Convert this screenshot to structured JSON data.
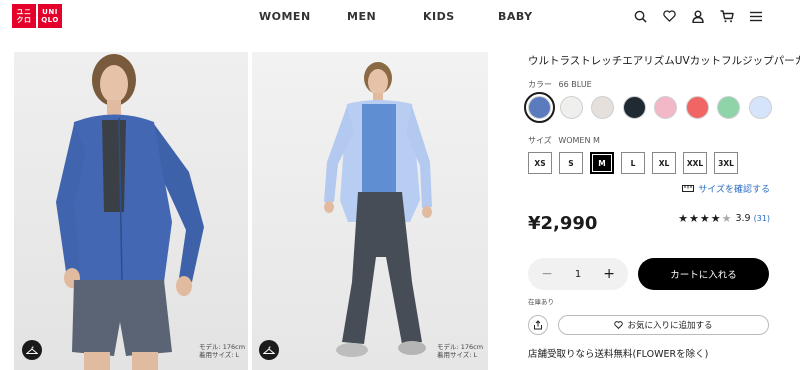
{
  "header": {
    "logo": {
      "top_left": "ユニ",
      "bottom_left": "クロ",
      "top_right": "UNI",
      "bottom_right": "QLO",
      "color": "#e4002b"
    },
    "nav": [
      "WOMEN",
      "MEN",
      "KIDS",
      "BABY"
    ],
    "icons": [
      "search-icon",
      "heart-icon",
      "user-icon",
      "cart-icon",
      "menu-icon"
    ]
  },
  "images": {
    "note_1_line1": "モデル: 176cm",
    "note_1_line2": "着用サイズ: L",
    "note_2_line1": "モデル: 176cm",
    "note_2_line2": "着用サイズ: L"
  },
  "product": {
    "title": "ウルトラストレッチエアリズムUVカットフルジップパーカ",
    "color_label": "カラー",
    "color_value": "66 BLUE",
    "swatches": [
      {
        "name": "blue",
        "hex": "#5b7bbf",
        "selected": true
      },
      {
        "name": "off-white",
        "hex": "#efefed"
      },
      {
        "name": "light-gray",
        "hex": "#e5e0dc"
      },
      {
        "name": "navy",
        "hex": "#1f2a33"
      },
      {
        "name": "pink",
        "hex": "#f2b8c8"
      },
      {
        "name": "red",
        "hex": "#f26565"
      },
      {
        "name": "green",
        "hex": "#8fd3a8"
      },
      {
        "name": "light-blue",
        "hex": "#d6e4fb"
      }
    ],
    "size_label": "サイズ",
    "size_value": "WOMEN M",
    "sizes": [
      "XS",
      "S",
      "M",
      "L",
      "XL",
      "XXL",
      "3XL"
    ],
    "selected_size": "M",
    "size_link": "サイズを確認する",
    "price": "¥2,990",
    "rating": {
      "stars_filled": 4,
      "stars_total": 5,
      "score": "3.9",
      "count": "(31)"
    },
    "quantity": "1",
    "cart_label": "カートに入れる",
    "stock_text": "在庫あり",
    "favorite_label": "お気に入りに追加する",
    "free_shipping": "店舗受取りなら送料無料(FLOWERを除く)",
    "link_color": "#2b6cc4"
  }
}
